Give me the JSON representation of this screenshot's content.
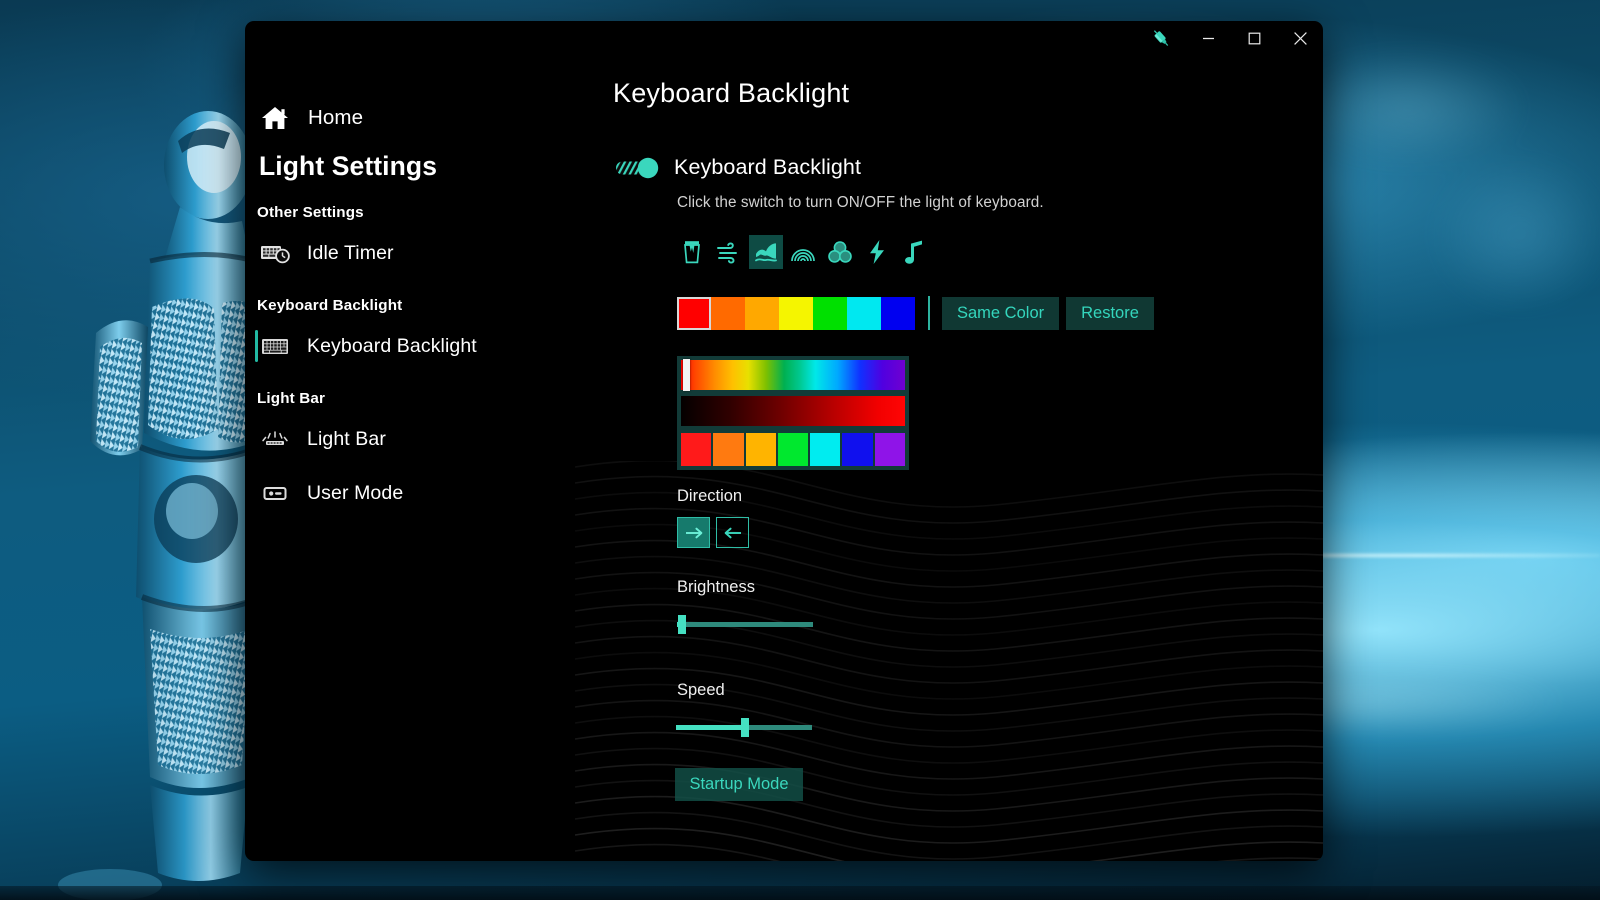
{
  "titlebar": {
    "theme_icon": "paintbrush-icon",
    "minimize_label": "–",
    "maximize_label": "☐",
    "close_label": "✕"
  },
  "sidebar": {
    "home_label": "Home",
    "home_icon": "home-icon",
    "title": "Light Settings",
    "groups": [
      {
        "heading": "Other Settings",
        "items": [
          {
            "label": "Idle Timer",
            "icon": "keyboard-clock-icon",
            "selected": false
          }
        ]
      },
      {
        "heading": "Keyboard Backlight",
        "items": [
          {
            "label": "Keyboard Backlight",
            "icon": "keyboard-icon",
            "selected": true
          }
        ]
      },
      {
        "heading": "Light Bar",
        "items": [
          {
            "label": "Light Bar",
            "icon": "lightbar-icon",
            "selected": false
          },
          {
            "label": "User Mode",
            "icon": "user-mode-icon",
            "selected": false
          }
        ]
      }
    ]
  },
  "main": {
    "page_title": "Keyboard Backlight",
    "toggle": {
      "label": "Keyboard Backlight",
      "description": "Click the switch to turn ON/OFF the light of keyboard.",
      "state": "on"
    },
    "effects": {
      "selected_index": 2,
      "items": [
        {
          "name": "glass-pour-icon",
          "label": "Glass"
        },
        {
          "name": "wind-icon",
          "label": "Wind"
        },
        {
          "name": "wave-icon",
          "label": "Wave"
        },
        {
          "name": "rainbow-icon",
          "label": "Rainbow"
        },
        {
          "name": "bubbles-icon",
          "label": "Bubbles"
        },
        {
          "name": "lightning-icon",
          "label": "Lightning"
        },
        {
          "name": "music-note-icon",
          "label": "Music"
        }
      ]
    },
    "palette": {
      "selected_index": 0,
      "swatches": [
        "#ff0000",
        "#ff6a00",
        "#ffa800",
        "#f5f500",
        "#00e000",
        "#00e8f0",
        "#0000f0"
      ],
      "same_color_label": "Same Color",
      "restore_label": "Restore"
    },
    "picker": {
      "hue_cursor_percent": 0,
      "presets": [
        "#ff1a1a",
        "#ff7a10",
        "#ffb400",
        "#00e82e",
        "#00ecf0",
        "#1010ee",
        "#8f14e8"
      ]
    },
    "direction": {
      "label": "Direction",
      "selected": "right",
      "right_icon": "arrow-right-icon",
      "left_icon": "arrow-left-icon"
    },
    "brightness": {
      "label": "Brightness",
      "percent": 3
    },
    "speed": {
      "label": "Speed",
      "percent": 47
    },
    "startup_button": "Startup Mode"
  },
  "colors": {
    "accent_teal": "#3ad7bd",
    "accent_dark": "#103833",
    "window_bg": "#000000",
    "wallpaper_blue": "#0e5c80"
  }
}
